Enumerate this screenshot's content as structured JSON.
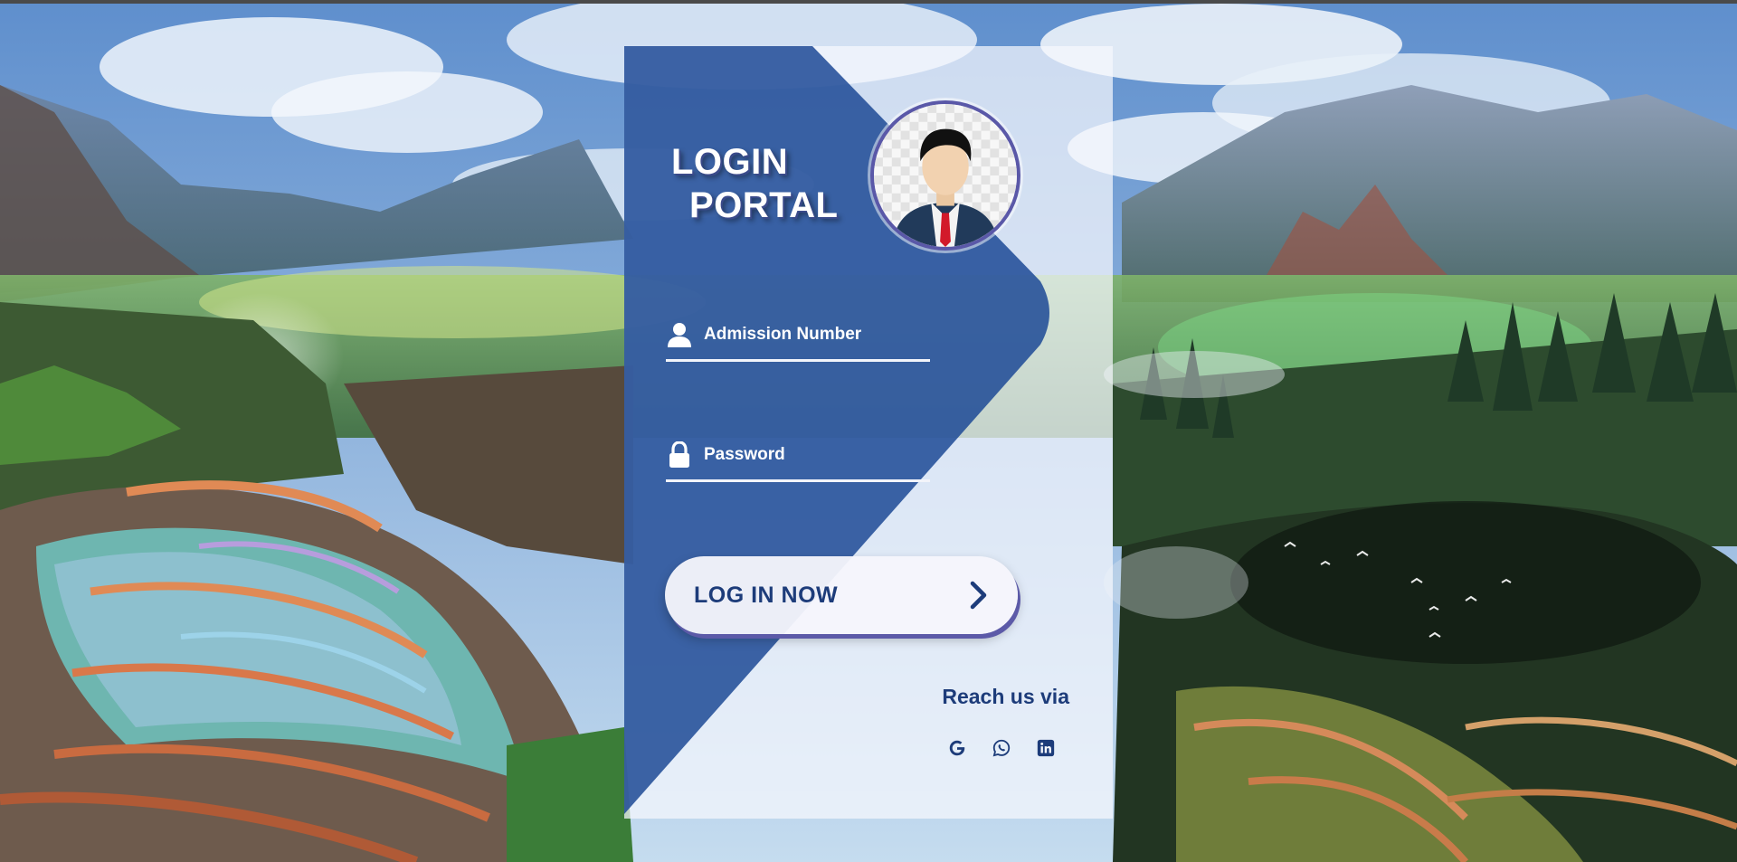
{
  "page": {
    "title_line1": "LOGIN",
    "title_line2": "PORTAL"
  },
  "form": {
    "admission_placeholder": "Admission Number",
    "admission_value": "",
    "password_placeholder": "Password",
    "password_value": "",
    "login_label": "LOG IN NOW"
  },
  "contact": {
    "label": "Reach us via",
    "icons": [
      "google-icon",
      "whatsapp-icon",
      "linkedin-icon"
    ]
  },
  "colors": {
    "panel_blue": "#1e4b96",
    "text_dark_blue": "#1d3c7a",
    "button_shadow": "#5c5aa8"
  }
}
